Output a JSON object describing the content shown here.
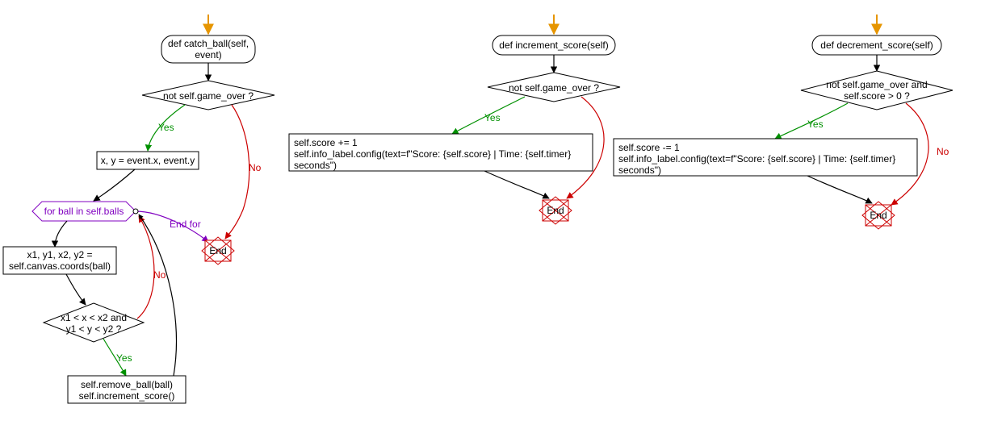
{
  "colors": {
    "arrow_start": "#e69500",
    "yes_edge": "#009000",
    "no_edge": "#cc0000",
    "for_purple": "#8000c0",
    "black": "#000000",
    "end_box": "#cc0000"
  },
  "labels": {
    "yes": "Yes",
    "no": "No",
    "end_for": "End for",
    "end": "End"
  },
  "chart_data": [
    {
      "type": "flowchart",
      "title": "catch_ball",
      "nodes": {
        "entry": "def catch_ball(self, event)",
        "guard": "not self.game_over ?",
        "assign1": "x, y = event.x, event.y",
        "for_loop": "for ball in self.balls",
        "assign2": "x1, y1, x2, y2 = self.canvas.coords(ball)",
        "cond2": "x1 < x < x2 and y1 < y < y2 ?",
        "body": "self.remove_ball(ball)\nself.increment_score()",
        "end": "End"
      },
      "edges": [
        [
          "entry",
          "guard",
          ""
        ],
        [
          "guard",
          "assign1",
          "Yes"
        ],
        [
          "guard",
          "end",
          "No"
        ],
        [
          "assign1",
          "for_loop",
          ""
        ],
        [
          "for_loop",
          "assign2",
          "iter"
        ],
        [
          "for_loop",
          "end",
          "End for"
        ],
        [
          "assign2",
          "cond2",
          ""
        ],
        [
          "cond2",
          "body",
          "Yes"
        ],
        [
          "cond2",
          "for_loop",
          "No"
        ],
        [
          "body",
          "for_loop",
          ""
        ]
      ]
    },
    {
      "type": "flowchart",
      "title": "increment_score",
      "nodes": {
        "entry": "def increment_score(self)",
        "guard": "not self.game_over ?",
        "body": "self.score += 1\nself.info_label.config(text=f\"Score: {self.score} | Time: {self.timer} seconds\")",
        "end": "End"
      },
      "edges": [
        [
          "entry",
          "guard",
          ""
        ],
        [
          "guard",
          "body",
          "Yes"
        ],
        [
          "guard",
          "end",
          "No"
        ],
        [
          "body",
          "end",
          ""
        ]
      ]
    },
    {
      "type": "flowchart",
      "title": "decrement_score",
      "nodes": {
        "entry": "def decrement_score(self)",
        "guard": "not self.game_over and self.score > 0 ?",
        "body": "self.score -= 1\nself.info_label.config(text=f\"Score: {self.score} | Time: {self.timer} seconds\")",
        "end": "End"
      },
      "edges": [
        [
          "entry",
          "guard",
          ""
        ],
        [
          "guard",
          "body",
          "Yes"
        ],
        [
          "guard",
          "end",
          "No"
        ],
        [
          "body",
          "end",
          ""
        ]
      ]
    }
  ],
  "fc1": {
    "entry_l1": "def catch_ball(self,",
    "entry_l2": "event)",
    "guard": "not self.game_over ?",
    "assign1": "x, y = event.x, event.y",
    "for_loop": "for ball in self.balls",
    "assign2_l1": "x1, y1, x2, y2 =",
    "assign2_l2": "self.canvas.coords(ball)",
    "cond2_l1": "x1 < x < x2 and",
    "cond2_l2": "y1 < y < y2 ?",
    "body_l1": "self.remove_ball(ball)",
    "body_l2": "self.increment_score()"
  },
  "fc2": {
    "entry": "def increment_score(self)",
    "guard": "not self.game_over ?",
    "body_l1": "self.score += 1",
    "body_l2": "self.info_label.config(text=f\"Score: {self.score} | Time: {self.timer}",
    "body_l3": "seconds\")"
  },
  "fc3": {
    "entry": "def decrement_score(self)",
    "guard_l1": "not self.game_over and",
    "guard_l2": "self.score > 0 ?",
    "body_l1": "self.score -= 1",
    "body_l2": "self.info_label.config(text=f\"Score: {self.score} | Time: {self.timer}",
    "body_l3": "seconds\")"
  }
}
